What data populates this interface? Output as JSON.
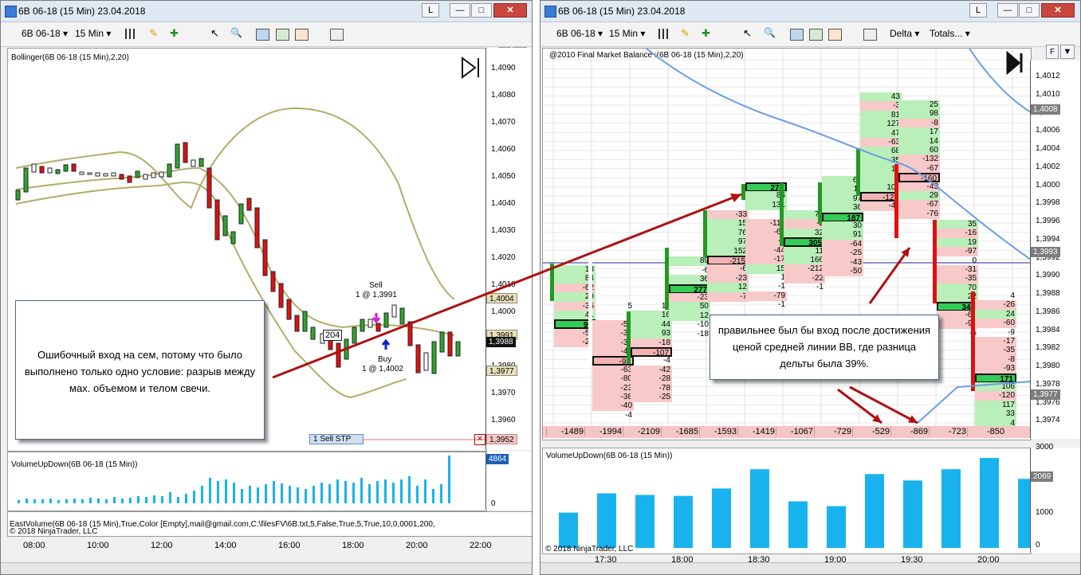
{
  "left": {
    "title": "6B 06-18 (15 Min)  23.04.2018",
    "win_btns": [
      "L",
      "—",
      "□",
      "✕"
    ],
    "toolbar": {
      "instrument": "6B 06-18",
      "interval": "15 Min"
    },
    "indicator_label": "Bollinger(6B 06-18 (15 Min),2,20)",
    "f_button": "F",
    "price_ticks": [
      "1,4090",
      "1,4080",
      "1,4070",
      "1,4060",
      "1,4050",
      "1,4040",
      "1,4030",
      "1,4020",
      "1,4010",
      "1,4000",
      "1,3990",
      "1,3980",
      "1,3970",
      "1,3960"
    ],
    "price_tags": {
      "upper": "1,4004",
      "mid": "1,3991",
      "last": "1,3988",
      "lower": "1,3977",
      "stop": "1,3952"
    },
    "entry_box": "204",
    "sell_label": "Sell",
    "sell_price": "1 @ 1,3991",
    "buy_label": "Buy",
    "buy_price": "1 @ 1,4002",
    "sell_stp": "1  Sell STP",
    "note": "Ошибочный вход на сем, потому что было выполнено только одно условие: разрыв между мах. объемом и телом свечи.",
    "volume_label": "VolumeUpDown(6B 06-18 (15 Min))",
    "volume_tag": "4864",
    "volume_zero": "0",
    "east_label": "EastVolume(6B 06-18 (15 Min),True,Color [Empty],mail@gmail.com,C:\\filesFV\\6B.txt,5,False,True,5,True,10,0,0001,200,",
    "copyright": "© 2018 NinjaTrader, LLC",
    "time_ticks": [
      "08:00",
      "10:00",
      "12:00",
      "14:00",
      "16:00",
      "18:00",
      "20:00",
      "22:00"
    ]
  },
  "right": {
    "title": "6B 06-18 (15 Min)  23.04.2018",
    "win_btns": [
      "L",
      "—",
      "□",
      "✕"
    ],
    "toolbar": {
      "instrument": "6B 06-18",
      "interval": "15 Min",
      "delta": "Delta",
      "totals": "Totals..."
    },
    "indicator_label": "@2010 Final Market Balance :(6B 06-18 (15 Min),2,20)",
    "f_button": "F",
    "price_ticks": [
      "1,4012",
      "1,4010",
      "1,4008",
      "1,4006",
      "1,4004",
      "1,4002",
      "1,4000",
      "1,3998",
      "1,3996",
      "1,3994",
      "1,3992",
      "1,3990",
      "1,3988",
      "1,3986",
      "1,3984",
      "1,3982",
      "1,3980",
      "1,3978",
      "1,3976",
      "1,3974"
    ],
    "price_tags": {
      "upper": "1,4008",
      "mid": "1,3993",
      "last": "1,3977"
    },
    "note": "правильнее был бы вход после достижения ценой средней линии BB, где разница дельты была 39%.",
    "delta_totals": [
      "-1489",
      "-1994",
      "-2109",
      "-1685",
      "-1593",
      "-1419",
      "-1067",
      "-729",
      "-529",
      "-869",
      "-723",
      "-850"
    ],
    "volume_label": "VolumeUpDown(6B 06-18 (15 Min))",
    "volume_ticks": [
      "3000",
      "2000",
      "1000",
      "0"
    ],
    "volume_tag": "2069",
    "volume_bars": [
      1100,
      1700,
      1650,
      1620,
      1850,
      2450,
      1450,
      1300,
      2300,
      2100,
      2450,
      2800,
      2150
    ],
    "copyright": "© 2018 NinjaTrader, LLC",
    "time_ticks": [
      "17:30",
      "18:00",
      "18:30",
      "19:00",
      "19:30",
      "20:00"
    ],
    "footprint": [
      {
        "col": 0,
        "cells": [
          [
            "13",
            "g"
          ],
          [
            "84",
            "g"
          ],
          [
            "-62",
            "r"
          ],
          [
            "29",
            "g"
          ],
          [
            "-35",
            "r"
          ],
          [
            "41",
            "g"
          ],
          [
            "90",
            "gb"
          ],
          [
            "-50",
            "r"
          ],
          [
            "-21",
            "r"
          ]
        ]
      },
      {
        "col": 1,
        "cells": [
          [
            "5",
            ""
          ],
          [
            "5",
            ""
          ],
          [
            "-52",
            "r"
          ],
          [
            "-30",
            "r"
          ],
          [
            "-36",
            "r"
          ],
          [
            "-45",
            "r"
          ],
          [
            "-94",
            "rb"
          ],
          [
            "-63",
            "r"
          ],
          [
            "-80",
            "r"
          ],
          [
            "-23",
            "r"
          ],
          [
            "-38",
            "r"
          ],
          [
            "-40",
            "r"
          ],
          [
            "-4",
            ""
          ]
        ]
      },
      {
        "col": 2,
        "cells": [
          [
            "10",
            ""
          ],
          [
            "16",
            "g"
          ],
          [
            "44",
            "g"
          ],
          [
            "93",
            "g"
          ],
          [
            "-18",
            "r"
          ],
          [
            "-107",
            "rb"
          ],
          [
            "-4",
            ""
          ],
          [
            "-42",
            "r"
          ],
          [
            "-28",
            "r"
          ],
          [
            "-78",
            "r"
          ],
          [
            "-25",
            "r"
          ]
        ]
      },
      {
        "col": 3,
        "cells": [
          [
            "1",
            ""
          ],
          [
            "89",
            "g"
          ],
          [
            "-6",
            ""
          ],
          [
            "36",
            "g"
          ],
          [
            "277",
            "gb"
          ],
          [
            "-23",
            "r"
          ],
          [
            "50",
            "g"
          ],
          [
            "12",
            "g"
          ],
          [
            "-10",
            ""
          ],
          [
            "-18",
            ""
          ]
        ]
      },
      {
        "col": 4,
        "cells": [
          [
            "-33",
            "r"
          ],
          [
            "15",
            "g"
          ],
          [
            "76",
            "g"
          ],
          [
            "97",
            "g"
          ],
          [
            "152",
            "g"
          ],
          [
            "-215",
            "rb"
          ],
          [
            "-6",
            "r"
          ],
          [
            "-23",
            "r"
          ],
          [
            "12",
            "g"
          ],
          [
            "-7",
            "r"
          ]
        ]
      },
      {
        "col": 5,
        "cells": [
          [
            "278",
            "gb"
          ],
          [
            "86",
            "g"
          ],
          [
            "131",
            "g"
          ],
          [
            "4",
            ""
          ],
          [
            "-114",
            "r"
          ],
          [
            "-68",
            "r"
          ],
          [
            "-2",
            "r"
          ],
          [
            "-44",
            "r"
          ],
          [
            "-17",
            "r"
          ],
          [
            "15",
            "g"
          ],
          [
            "1",
            ""
          ],
          [
            "-1",
            ""
          ],
          [
            "-79",
            "r"
          ],
          [
            "-1",
            ""
          ]
        ]
      },
      {
        "col": 6,
        "cells": [
          [
            "75",
            "g"
          ],
          [
            "-2",
            "r"
          ],
          [
            "32",
            "g"
          ],
          [
            "305",
            "gb"
          ],
          [
            "11",
            "g"
          ],
          [
            "166",
            "g"
          ],
          [
            "-212",
            "r"
          ],
          [
            "-22",
            "r"
          ],
          [
            "-1",
            ""
          ]
        ]
      },
      {
        "col": 7,
        "cells": [
          [
            "68",
            "g"
          ],
          [
            "11",
            "g"
          ],
          [
            "97",
            "g"
          ],
          [
            "36",
            "g"
          ],
          [
            "187",
            "gb"
          ],
          [
            "30",
            "g"
          ],
          [
            "91",
            "g"
          ],
          [
            "-64",
            "r"
          ],
          [
            "-25",
            "r"
          ],
          [
            "-43",
            "r"
          ],
          [
            "-50",
            "r"
          ]
        ]
      },
      {
        "col": 8,
        "cells": [
          [
            "43",
            "g"
          ],
          [
            "-3",
            "r"
          ],
          [
            "81",
            "g"
          ],
          [
            "127",
            "g"
          ],
          [
            "47",
            "g"
          ],
          [
            "-63",
            "r"
          ],
          [
            "68",
            "g"
          ],
          [
            "35",
            "g"
          ],
          [
            "12",
            "g"
          ],
          [
            "2",
            "g"
          ],
          [
            "109",
            "g"
          ],
          [
            "-128",
            "rb"
          ],
          [
            "-43",
            "r"
          ]
        ]
      },
      {
        "col": 9,
        "cells": [
          [
            "25",
            "g"
          ],
          [
            "98",
            "g"
          ],
          [
            "-8",
            "r"
          ],
          [
            "17",
            "g"
          ],
          [
            "14",
            "g"
          ],
          [
            "60",
            "g"
          ],
          [
            "-132",
            "r"
          ],
          [
            "-67",
            "r"
          ],
          [
            "-160",
            "rb"
          ],
          [
            "-43",
            "r"
          ],
          [
            "29",
            "g"
          ],
          [
            "-67",
            "r"
          ],
          [
            "-76",
            "r"
          ]
        ]
      },
      {
        "col": 10,
        "cells": [
          [
            "35",
            "g"
          ],
          [
            "-16",
            "r"
          ],
          [
            "19",
            "g"
          ],
          [
            "-97",
            "r"
          ],
          [
            "0",
            ""
          ],
          [
            "-31",
            "r"
          ],
          [
            "-35",
            "r"
          ],
          [
            "70",
            "g"
          ],
          [
            "22",
            "g"
          ],
          [
            "342",
            "gb"
          ],
          [
            "-68",
            "r"
          ],
          [
            "-90",
            "r"
          ],
          [
            "-5",
            ""
          ]
        ]
      },
      {
        "col": 11,
        "cells": [
          [
            "4",
            ""
          ],
          [
            "-26",
            "r"
          ],
          [
            "24",
            "g"
          ],
          [
            "-60",
            "r"
          ],
          [
            "-9",
            ""
          ],
          [
            "-17",
            "r"
          ],
          [
            "-35",
            "r"
          ],
          [
            "-8",
            "r"
          ],
          [
            "-93",
            "r"
          ],
          [
            "171",
            "gb"
          ],
          [
            "106",
            "g"
          ],
          [
            "-120",
            "r"
          ],
          [
            "117",
            "g"
          ],
          [
            "33",
            "g"
          ],
          [
            "4",
            "g"
          ]
        ]
      }
    ]
  }
}
